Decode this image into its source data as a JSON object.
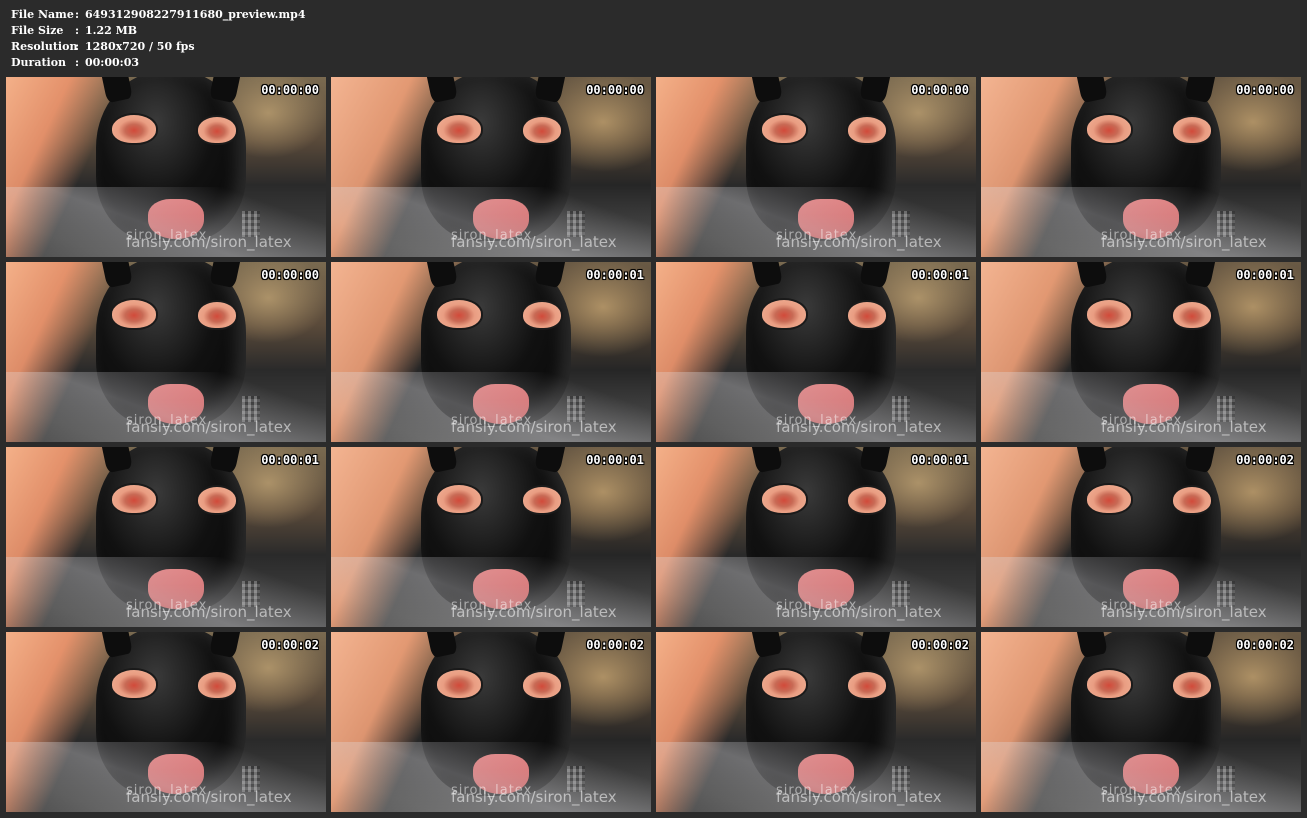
{
  "info": {
    "separator": ":",
    "rows": [
      {
        "label": "File Name",
        "value": "649312908227911680_preview.mp4"
      },
      {
        "label": "File Size",
        "value": "1.22 MB"
      },
      {
        "label": "Resolution",
        "value": "1280x720 / 50 fps"
      },
      {
        "label": "Duration",
        "value": "00:00:03"
      }
    ]
  },
  "thumbnails": {
    "timestamps": [
      "00:00:00",
      "00:00:00",
      "00:00:00",
      "00:00:00",
      "00:00:00",
      "00:00:01",
      "00:00:01",
      "00:00:01",
      "00:00:01",
      "00:00:01",
      "00:00:01",
      "00:00:02",
      "00:00:02",
      "00:00:02",
      "00:00:02",
      "00:00:02"
    ],
    "watermark_url": "fansly.com/siron_latex",
    "watermark_handle": "siron_latex"
  }
}
